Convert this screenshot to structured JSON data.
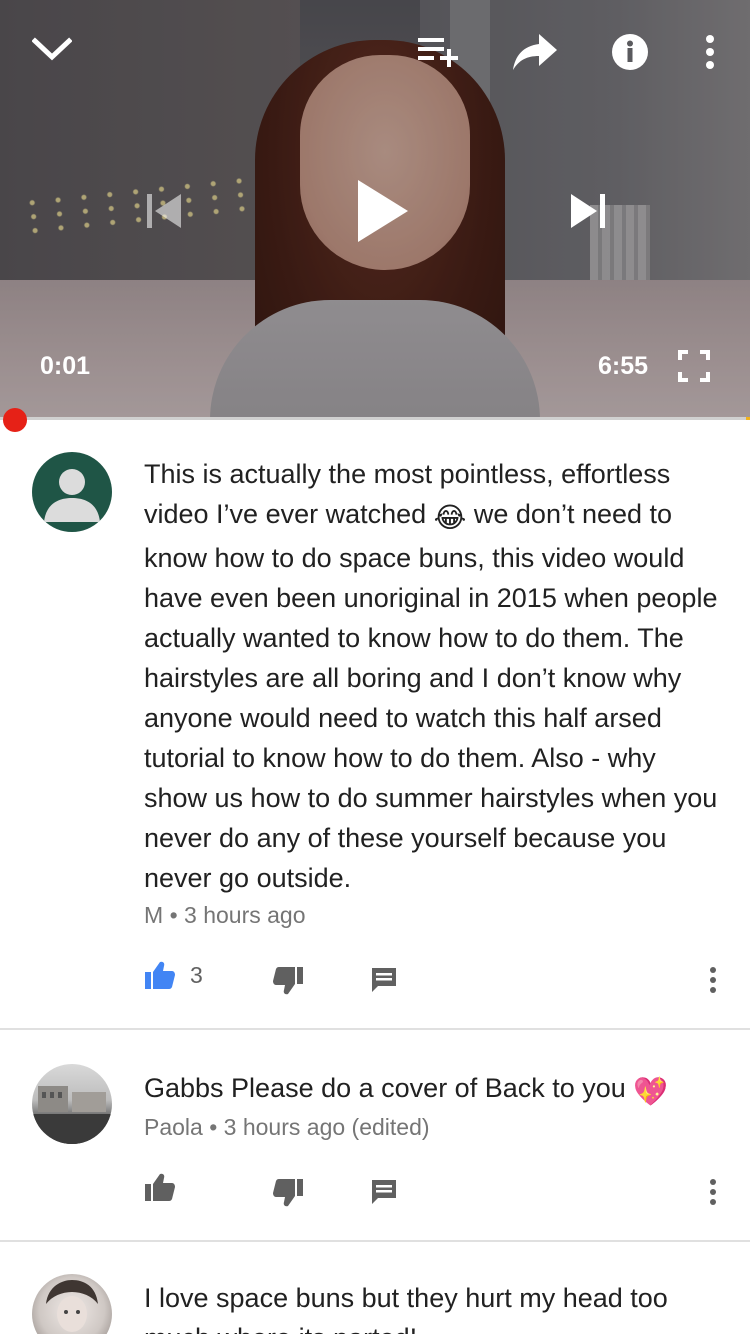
{
  "player": {
    "current_time": "0:01",
    "duration": "6:55",
    "progress_fraction": 0.0024,
    "icons": {
      "collapse": "chevron-down-icon",
      "add_to_playlist": "playlist-add-icon",
      "share": "share-icon",
      "info": "info-icon",
      "more": "more-vert-icon",
      "previous": "skip-previous-icon",
      "play": "play-icon",
      "next": "skip-next-icon",
      "fullscreen": "fullscreen-icon"
    },
    "colors": {
      "scrubber": "#e62117",
      "buffer_end": "#f2b21c"
    }
  },
  "comments": [
    {
      "text_parts": [
        "This is actually the most pointless, effortless video I’ve ever watched",
        "😂",
        " we don’t need to know how to do space buns, this video would have even been unoriginal in 2015 when people actually wanted to know how to do them. The hairstyles are all boring and I don’t know why anyone would need to watch this half arsed tutorial to know how to do them. Also - why show us how to do summer hairstyles when you never do any of these yourself because you never go outside."
      ],
      "author": "M",
      "time": "3 hours ago",
      "likes": "3",
      "liked": true
    },
    {
      "text": "Gabbs Please do a cover of Back to you",
      "emoji": "💖",
      "author": "Paola",
      "time": "3 hours ago (edited)",
      "likes": ""
    },
    {
      "text": "I love space buns but they hurt my head too much where its parted!"
    }
  ],
  "meta_separator": "•",
  "colors": {
    "like_active": "#4285f4",
    "icon_gray": "#606060"
  }
}
